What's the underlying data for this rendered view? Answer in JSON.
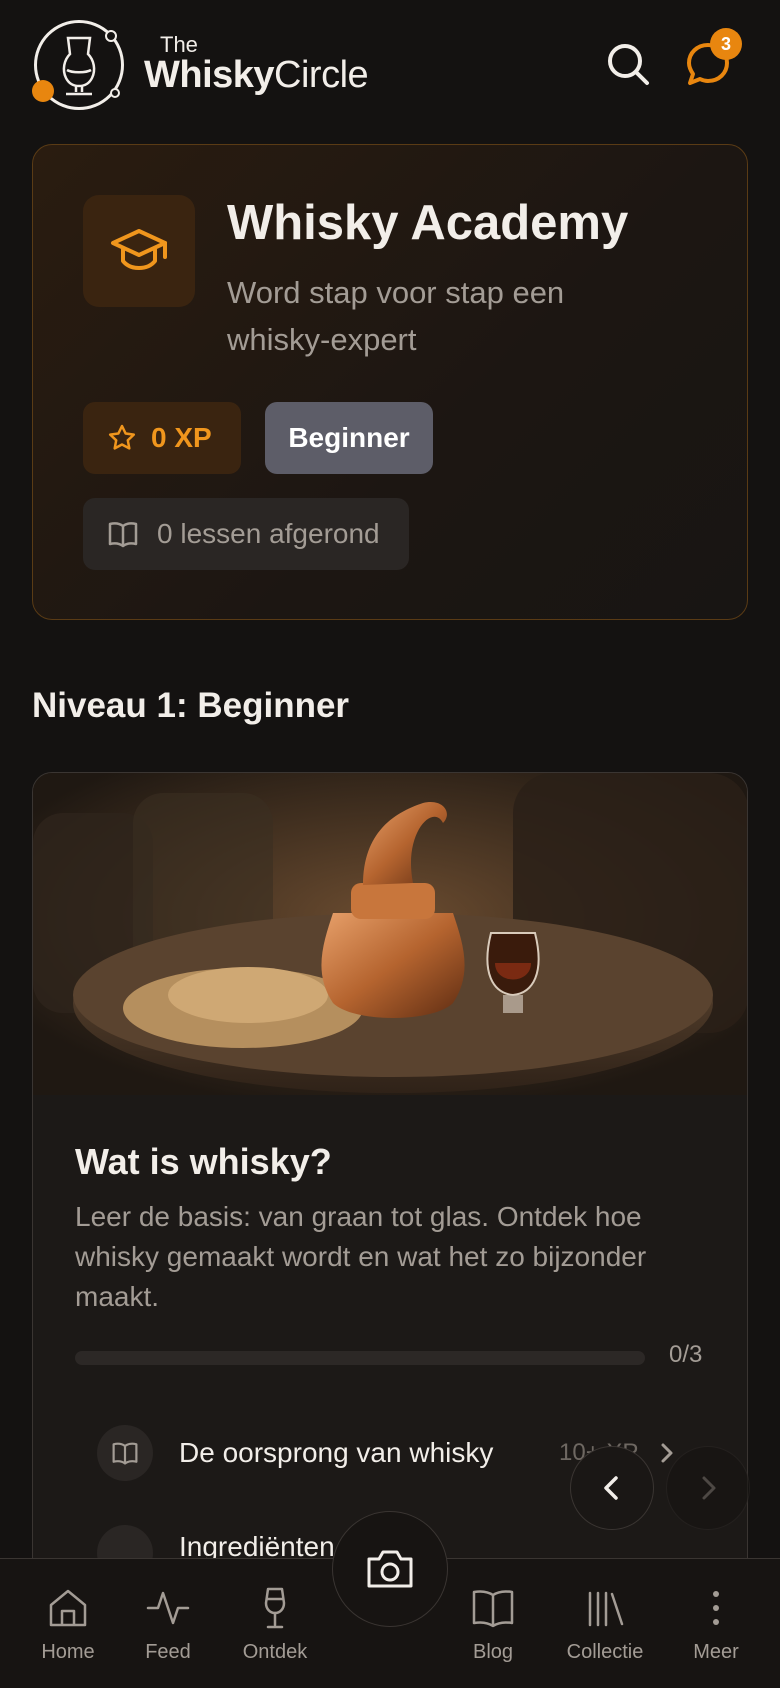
{
  "header": {
    "logo_the": "The",
    "logo_whisky": "Whisky",
    "logo_circle": "Circle",
    "notification_count": "3",
    "accent_color": "#e8860f"
  },
  "academy": {
    "title": "Whisky Academy",
    "subtitle": "Word stap voor stap een whisky-expert",
    "xp": "0 XP",
    "level": "Beginner",
    "lessons_completed": "0 lessen afgerond"
  },
  "section": {
    "title": "Niveau 1: Beginner"
  },
  "lesson_card": {
    "title": "Wat is whisky?",
    "description": "Leer de basis: van graan tot glas. Ontdek hoe whisky gemaakt wordt en wat het zo bijzonder maakt.",
    "progress_label": "0/3",
    "progress_fraction": 0,
    "lessons": [
      {
        "label": "De oorsprong van whisky",
        "xp": "10+ XP"
      },
      {
        "label": "Ingrediënten"
      }
    ]
  },
  "bottom_nav": {
    "items": [
      {
        "label": "Home",
        "icon": "home-icon"
      },
      {
        "label": "Feed",
        "icon": "activity-icon"
      },
      {
        "label": "Ontdek",
        "icon": "glass-icon"
      },
      {
        "label": "Blog",
        "icon": "book-icon"
      },
      {
        "label": "Collectie",
        "icon": "library-icon"
      },
      {
        "label": "Meer",
        "icon": "more-vertical-icon"
      }
    ],
    "center_icon": "camera-icon"
  }
}
